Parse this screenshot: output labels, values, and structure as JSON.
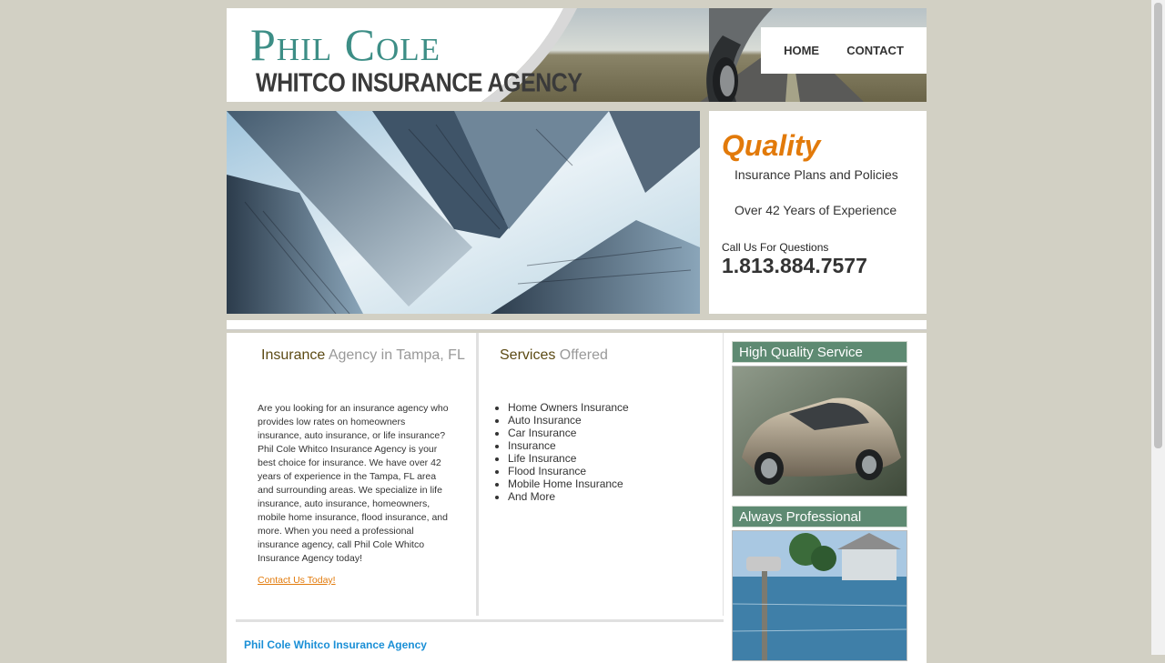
{
  "header": {
    "logo_name": "Phil Cole",
    "logo_agency": "WHITCO INSURANCE AGENCY",
    "nav": [
      {
        "label": "HOME"
      },
      {
        "label": "CONTACT"
      }
    ]
  },
  "hero": {
    "quality_title": "Quality",
    "line1": "Insurance Plans and Policies",
    "line2": "Over 42 Years of Experience",
    "call_label": "Call Us For Questions",
    "phone": "1.813.884.7577"
  },
  "col1": {
    "head_dark": "Insurance",
    "head_light": " Agency in Tampa, FL",
    "body": "Are you looking for an insurance agency who provides low rates on homeowners insurance, auto insurance, or life insurance? Phil Cole Whitco Insurance Agency is your best choice for insurance. We have over 42 years of experience in the Tampa, FL area and surrounding areas. We specialize in life insurance, auto insurance, homeowners, mobile home insurance, flood insurance, and more. When you need a professional insurance agency, call Phil Cole Whitco Insurance Agency today!",
    "contact_link": "Contact Us Today!"
  },
  "col2": {
    "head_dark": "Services",
    "head_light": " Offered",
    "services": [
      "Home Owners Insurance",
      "Auto Insurance",
      "Car Insurance",
      "Insurance",
      "Life Insurance",
      "Flood Insurance",
      "Mobile Home Insurance",
      "And More"
    ]
  },
  "sidebar": {
    "head1": "High Quality Service",
    "head2": "Always Professional"
  },
  "footer": {
    "name": "Phil Cole Whitco Insurance Agency"
  },
  "colors": {
    "accent_orange": "#e27a0a",
    "logo_teal": "#3d8e86",
    "sidebar_green": "#5e8a72",
    "footer_blue": "#1a8fd6"
  }
}
